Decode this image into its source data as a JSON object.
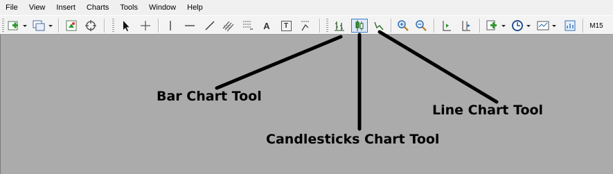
{
  "menu": {
    "items": [
      {
        "label": "File"
      },
      {
        "label": "View"
      },
      {
        "label": "Insert"
      },
      {
        "label": "Charts"
      },
      {
        "label": "Tools"
      },
      {
        "label": "Window"
      },
      {
        "label": "Help"
      }
    ]
  },
  "toolbar": {
    "timeframe_label": "M15",
    "line_tools": [
      "vertical-line",
      "horizontal-line",
      "trendline",
      "equidistant-channel",
      "fibonacci-retracement",
      "text",
      "text-label",
      "arrows"
    ],
    "line_tools_text": {
      "text_tool": "A",
      "text_label_tool": "T"
    },
    "active_chart_type": "candlesticks"
  },
  "annotations": {
    "bar_chart": "Bar Chart Tool",
    "candlesticks_chart": "Candlesticks Chart Tool",
    "line_chart": "Line Chart Tool"
  },
  "colors": {
    "canvas": "#ababab",
    "toolbar": "#f3f3f3",
    "icon_green": "#2f9a2f",
    "icon_blue": "#2b6cb0"
  }
}
